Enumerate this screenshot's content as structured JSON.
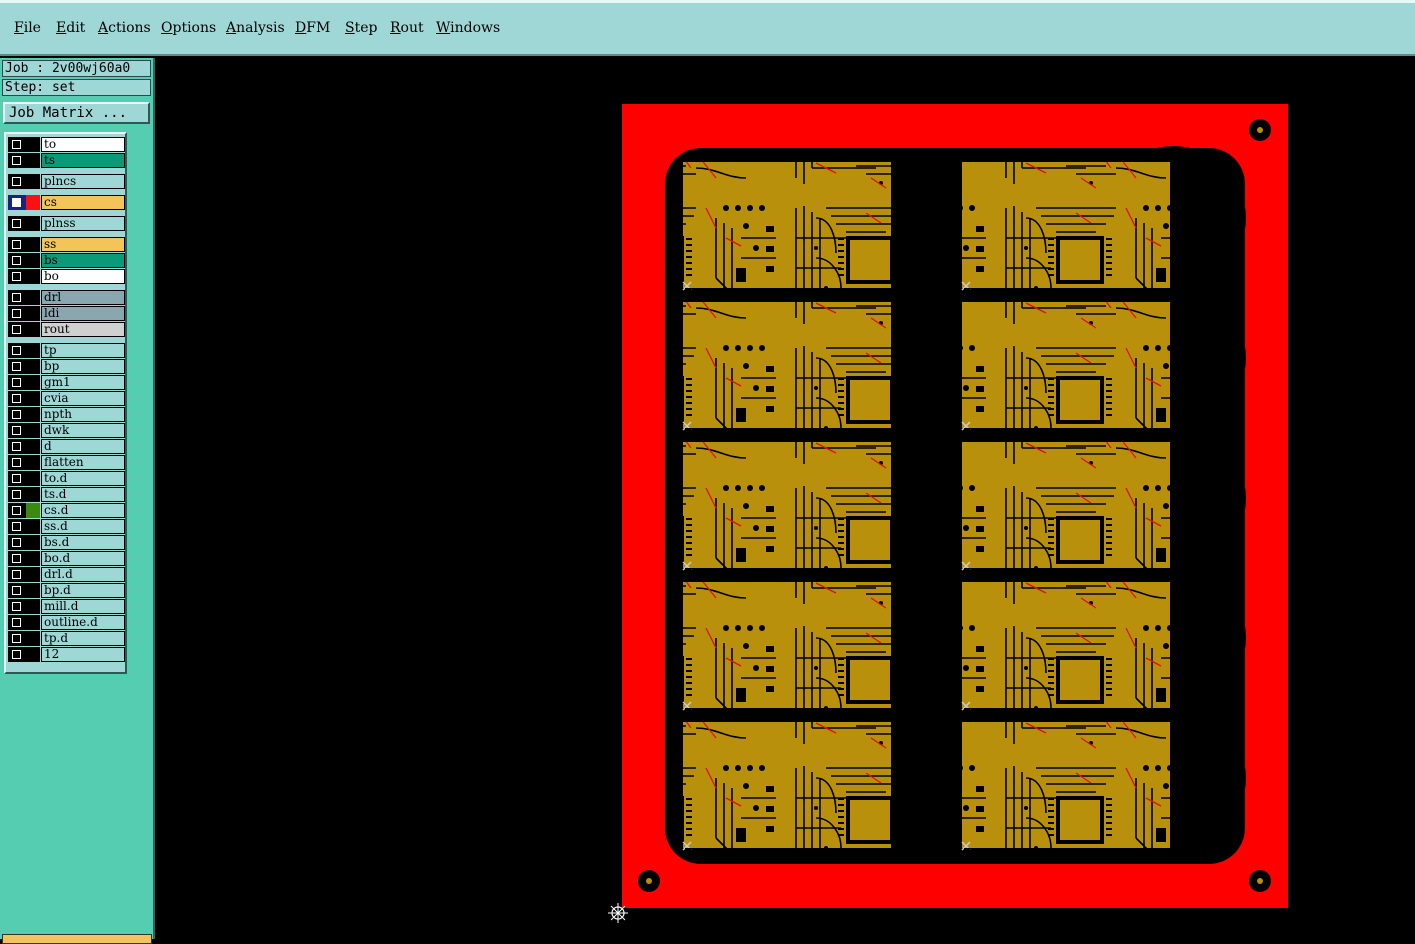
{
  "menu": [
    "File",
    "Edit",
    "Actions",
    "Options",
    "Analysis",
    "DFM",
    "Step",
    "Rout",
    "Windows"
  ],
  "job": {
    "label": "Job : 2v00wj60a0",
    "step": "Step: set",
    "matrix_button": "Job Matrix ..."
  },
  "layers": [
    {
      "name": "to",
      "color": "#ffffff"
    },
    {
      "name": "ts",
      "color": "#0a9a78"
    },
    {
      "name": "plncs",
      "color": "#9fd6d6"
    },
    {
      "name": "cs",
      "color": "#f2c45a",
      "active": true
    },
    {
      "name": "plnss",
      "color": "#9fd6d6"
    },
    {
      "name": "ss",
      "color": "#f2c45a"
    },
    {
      "name": "bs",
      "color": "#0a9a78"
    },
    {
      "name": "bo",
      "color": "#ffffff"
    },
    {
      "name": "drl",
      "color": "#8aa7b0"
    },
    {
      "name": "ldi",
      "color": "#8aa7b0"
    },
    {
      "name": "rout",
      "color": "#d0d0d0"
    },
    {
      "name": "tp",
      "color": "#9fd6d6"
    },
    {
      "name": "bp",
      "color": "#9fd6d6"
    },
    {
      "name": "gm1",
      "color": "#9fd6d6"
    },
    {
      "name": "cvia",
      "color": "#9fd6d6"
    },
    {
      "name": "npth",
      "color": "#9fd6d6"
    },
    {
      "name": "dwk",
      "color": "#9fd6d6"
    },
    {
      "name": "d",
      "color": "#9fd6d6"
    },
    {
      "name": "flatten",
      "color": "#9fd6d6"
    },
    {
      "name": "to.d",
      "color": "#9fd6d6"
    },
    {
      "name": "ts.d",
      "color": "#9fd6d6"
    },
    {
      "name": "cs.d",
      "color": "#9fd6d6"
    },
    {
      "name": "ss.d",
      "color": "#9fd6d6"
    },
    {
      "name": "bs.d",
      "color": "#9fd6d6"
    },
    {
      "name": "bo.d",
      "color": "#9fd6d6"
    },
    {
      "name": "drl.d",
      "color": "#9fd6d6"
    },
    {
      "name": "bp.d",
      "color": "#9fd6d6"
    },
    {
      "name": "mill.d",
      "color": "#9fd6d6"
    },
    {
      "name": "outline.d",
      "color": "#9fd6d6"
    },
    {
      "name": "tp.d",
      "color": "#9fd6d6"
    },
    {
      "name": "12",
      "color": "#9fd6d6"
    }
  ],
  "colors": {
    "panel_copper": "#ff0000",
    "board_copper": "#b8900c",
    "board_bg": "#000000",
    "trace_red": "#e01010"
  }
}
